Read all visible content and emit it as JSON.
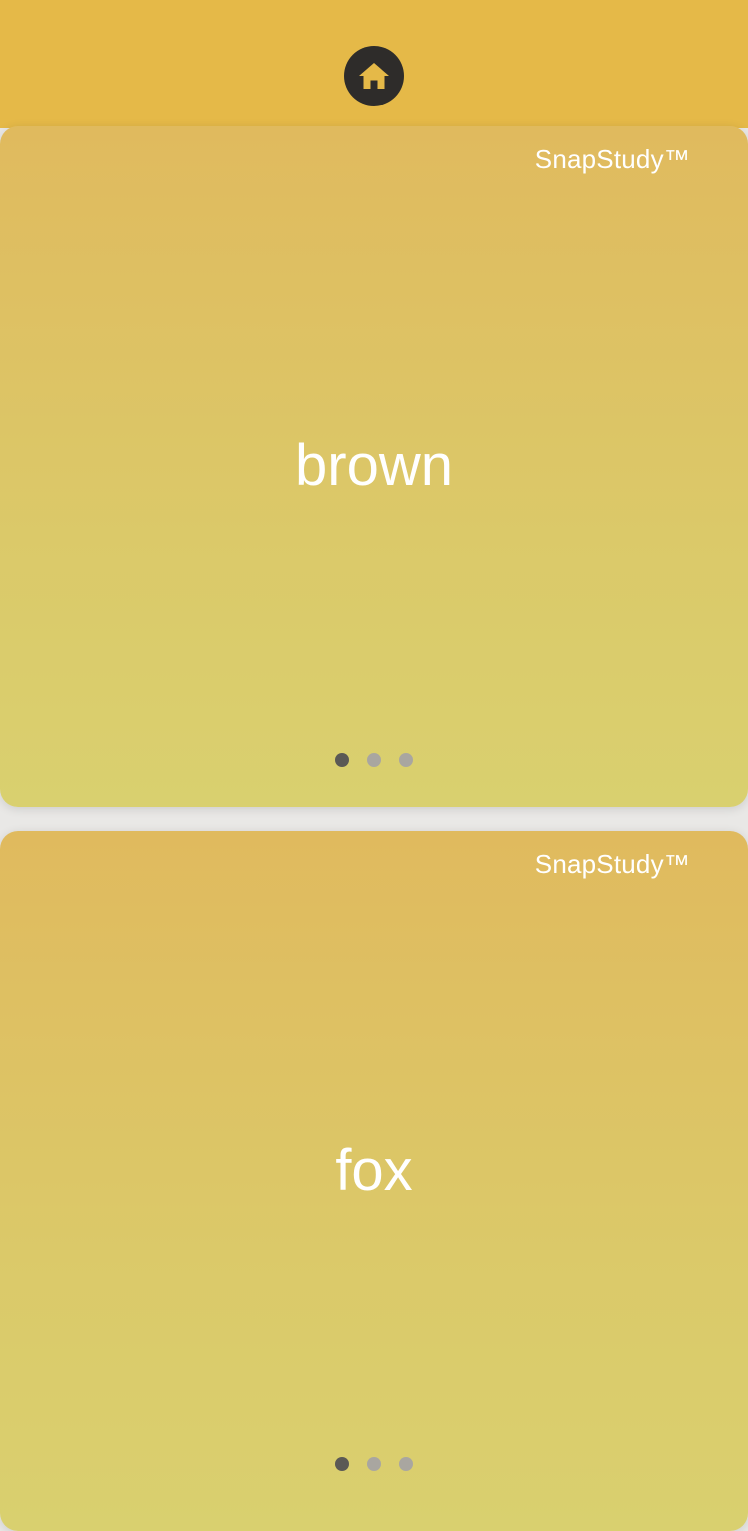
{
  "header": {
    "home_icon": "home-icon",
    "background": "#e5b948"
  },
  "cards": [
    {
      "brand": "SnapStudy™",
      "word": "brown",
      "pager": {
        "total": 3,
        "active": 1
      }
    },
    {
      "brand": "SnapStudy™",
      "word": "fox",
      "pager": {
        "total": 3,
        "active": 1
      }
    }
  ],
  "colors": {
    "accent": "#e5b948",
    "card_top": "#e0ba5e",
    "card_bottom": "#d9d06f",
    "dot_active": "#5b5955",
    "dot_inactive": "#a9a6a0"
  }
}
